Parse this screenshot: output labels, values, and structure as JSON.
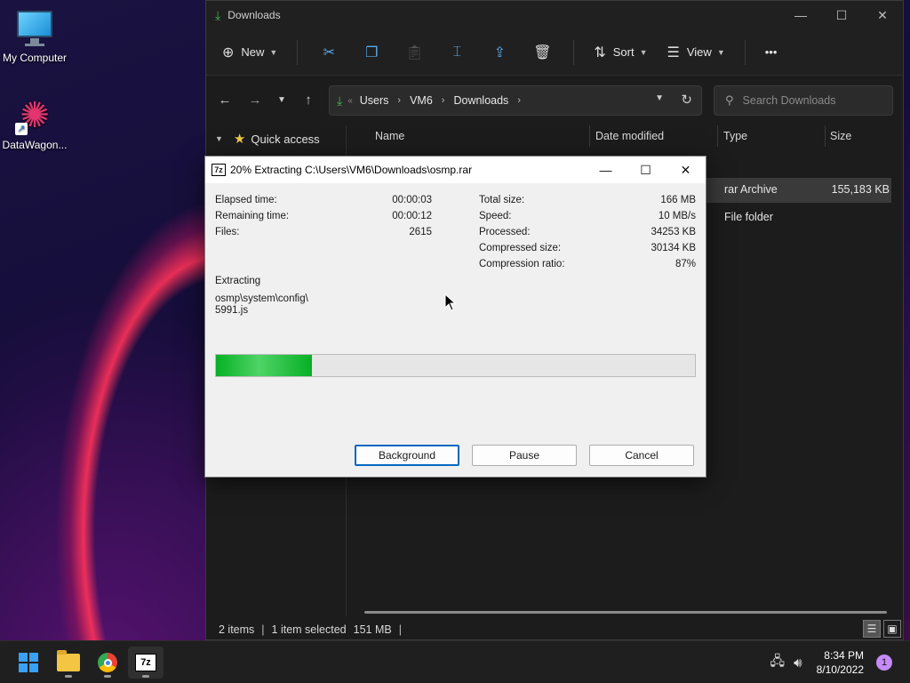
{
  "desktop": {
    "icons": [
      {
        "label": "My Computer"
      },
      {
        "label": "DataWagon..."
      }
    ]
  },
  "explorer": {
    "title": "Downloads",
    "toolbar": {
      "new_label": "New",
      "sort_label": "Sort",
      "view_label": "View",
      "more_label": "•••"
    },
    "address": {
      "crumbs": [
        "Users",
        "VM6",
        "Downloads"
      ]
    },
    "search": {
      "placeholder": "Search Downloads"
    },
    "nav": {
      "quick_access_label": "Quick access"
    },
    "columns": {
      "name": "Name",
      "date_modified": "Date modified",
      "type": "Type",
      "size": "Size"
    },
    "files": [
      {
        "type": "rar Archive",
        "size": "155,183 KB",
        "selected": true
      },
      {
        "type": "File folder",
        "size": ""
      }
    ],
    "status": {
      "items": "2 items",
      "selection": "1 item selected",
      "selected_size": "151 MB"
    }
  },
  "dialog": {
    "title": "20% Extracting C:\\Users\\VM6\\Downloads\\osmp.rar",
    "stats_left": [
      {
        "key": "Elapsed time:",
        "value": "00:00:03"
      },
      {
        "key": "Remaining time:",
        "value": "00:00:12"
      },
      {
        "key": "Files:",
        "value": "2615"
      }
    ],
    "stats_right": [
      {
        "key": "Total size:",
        "value": "166 MB"
      },
      {
        "key": "Speed:",
        "value": "10 MB/s"
      },
      {
        "key": "Processed:",
        "value": "34253 KB"
      },
      {
        "key": "Compressed size:",
        "value": "30134 KB"
      },
      {
        "key": "Compression ratio:",
        "value": "87%"
      }
    ],
    "operation_label": "Extracting",
    "current_file_line1": "osmp\\system\\config\\",
    "current_file_line2": "5991.js",
    "progress_fraction": 0.2,
    "buttons": {
      "background": "Background",
      "pause": "Pause",
      "cancel": "Cancel"
    }
  },
  "taskbar": {
    "time": "8:34 PM",
    "date": "8/10/2022",
    "notification_count": "1"
  },
  "colors": {
    "progress_green": "#06b025",
    "accent_blue": "#0067c0",
    "explorer_bg": "#1c1c1c"
  }
}
